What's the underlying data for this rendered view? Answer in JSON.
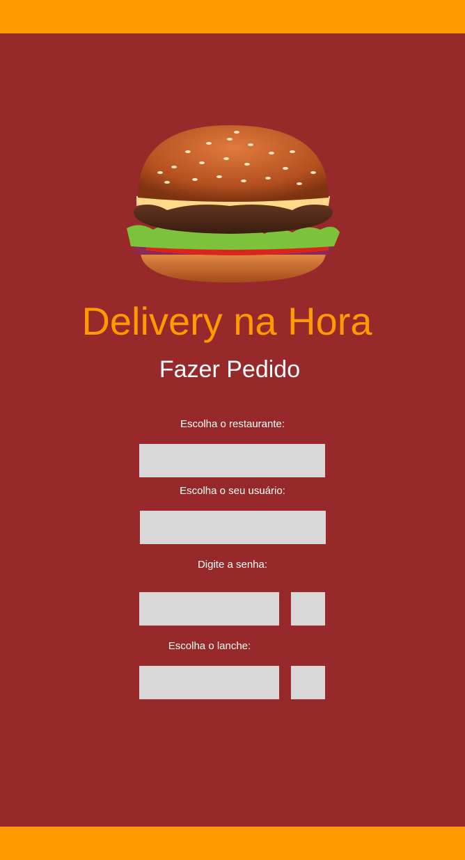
{
  "app": {
    "title": "Delivery na Hora",
    "subtitle": "Fazer Pedido"
  },
  "form": {
    "restaurant": {
      "label": "Escolha o restaurante:",
      "value": ""
    },
    "user": {
      "label": "Escolha o seu usuário:",
      "value": ""
    },
    "password": {
      "label": "Digite a senha:",
      "value": ""
    },
    "snack": {
      "label": "Escolha o lanche:",
      "value": ""
    }
  },
  "image": {
    "icon": "hamburger-illustration"
  },
  "colors": {
    "background": "#98292b",
    "accent": "#ff9a00",
    "field": "#d8d8d8",
    "text": "#ffffff"
  }
}
